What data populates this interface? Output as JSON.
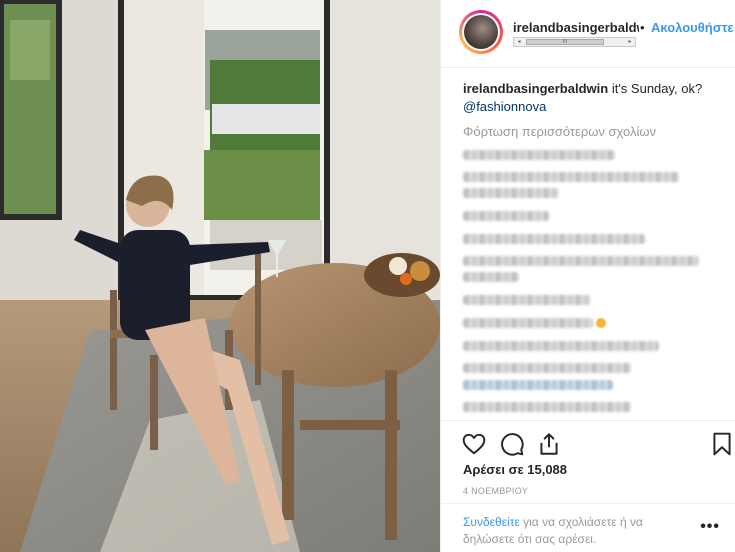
{
  "post": {
    "username": "irelandbasingerbaldwin",
    "separator": "•",
    "follow_label": "Ακολουθήστε",
    "scroll_arrow_left": "◂",
    "scroll_arrow_right": "▸",
    "scroll_thumb_grip": "III",
    "caption_text": "it's Sunday, ok?",
    "caption_tag": "@fashionnova",
    "load_more_label": "Φόρτωση περισσότερων σχολίων",
    "likes_label": "Αρέσει σε 15,088",
    "date_label": "4 ΝΟΕΜΒΡΙΟΥ",
    "login_link": "Συνδεθείτε",
    "login_text": " για να σχολιάσετε ή να δηλώσετε ότι σας αρέσει.",
    "more_label": "•••"
  },
  "icons": {
    "heart": "heart-icon",
    "comment": "comment-icon",
    "share": "share-icon",
    "bookmark": "bookmark-icon"
  },
  "colors": {
    "accent": "#3897f0",
    "tag": "#003569",
    "muted": "#999999",
    "text": "#262626"
  }
}
